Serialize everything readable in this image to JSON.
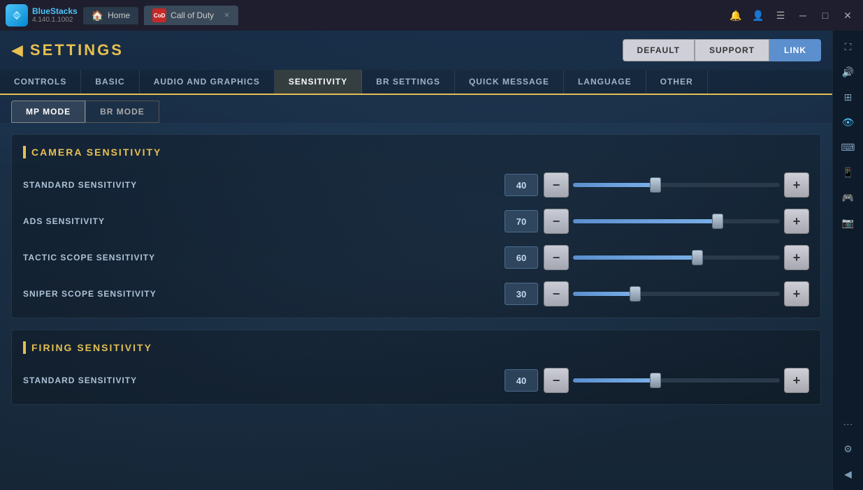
{
  "titlebar": {
    "bs_name": "BlueStacks",
    "bs_version": "4.140.1.1002",
    "home_tab": "Home",
    "cod_tab": "Call of Duty",
    "bell_icon": "🔔",
    "account_icon": "👤",
    "menu_icon": "☰",
    "minimize_icon": "─",
    "maximize_icon": "□",
    "close_icon": "✕",
    "expand_icon": "⛶"
  },
  "settings": {
    "back_label": "◀",
    "title": "SETTINGS",
    "buttons": {
      "default": "DEFAULT",
      "support": "SUPPORT",
      "link": "LINK"
    }
  },
  "main_tabs": [
    {
      "id": "controls",
      "label": "CONTROLS",
      "active": false
    },
    {
      "id": "basic",
      "label": "BASIC",
      "active": false
    },
    {
      "id": "audio_graphics",
      "label": "AUDIO AND GRAPHICS",
      "active": false
    },
    {
      "id": "sensitivity",
      "label": "SENSITIVITY",
      "active": true
    },
    {
      "id": "br_settings",
      "label": "BR SETTINGS",
      "active": false
    },
    {
      "id": "quick_message",
      "label": "QUICK MESSAGE",
      "active": false
    },
    {
      "id": "language",
      "label": "LANGUAGE",
      "active": false
    },
    {
      "id": "other",
      "label": "OTHER",
      "active": false
    }
  ],
  "sub_tabs": [
    {
      "id": "mp_mode",
      "label": "MP MODE",
      "active": true
    },
    {
      "id": "br_mode",
      "label": "BR MODE",
      "active": false
    }
  ],
  "camera_sensitivity": {
    "title": "CAMERA SENSITIVITY",
    "rows": [
      {
        "label": "STANDARD SENSITIVITY",
        "value": "40",
        "percent": 40
      },
      {
        "label": "ADS SENSITIVITY",
        "value": "70",
        "percent": 70
      },
      {
        "label": "TACTIC SCOPE SENSITIVITY",
        "value": "60",
        "percent": 60
      },
      {
        "label": "SNIPER SCOPE SENSITIVITY",
        "value": "30",
        "percent": 30
      }
    ]
  },
  "firing_sensitivity": {
    "title": "FIRING SENSITIVITY",
    "rows": [
      {
        "label": "STANDARD SENSITIVITY",
        "value": "40",
        "percent": 40
      }
    ]
  },
  "right_sidebar_icons": [
    "⛶",
    "⊕",
    "⌨",
    "📱",
    "🎮",
    "📷",
    "···",
    "⚙",
    "◀"
  ]
}
